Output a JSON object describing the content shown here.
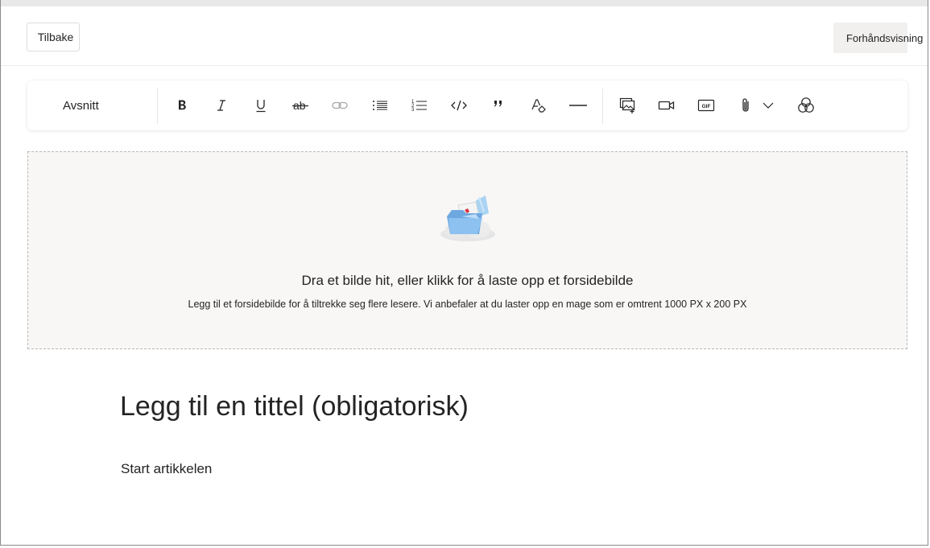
{
  "header": {
    "back_label": "Tilbake",
    "preview_label": "Forhåndsvisning"
  },
  "toolbar": {
    "paragraph_style": "Avsnitt",
    "buttons": [
      {
        "name": "bold",
        "icon": "bold-icon"
      },
      {
        "name": "italic",
        "icon": "italic-icon"
      },
      {
        "name": "underline",
        "icon": "underline-icon"
      },
      {
        "name": "strikethrough",
        "icon": "strikethrough-icon"
      },
      {
        "name": "link",
        "icon": "link-icon"
      },
      {
        "name": "bulleted-list",
        "icon": "bulleted-list-icon"
      },
      {
        "name": "numbered-list",
        "icon": "numbered-list-icon"
      },
      {
        "name": "code",
        "icon": "code-icon"
      },
      {
        "name": "quote",
        "icon": "quote-icon"
      },
      {
        "name": "clear-formatting",
        "icon": "clear-formatting-icon"
      },
      {
        "name": "horizontal-rule",
        "icon": "horizontal-rule-icon"
      },
      {
        "name": "insert-image",
        "icon": "image-icon"
      },
      {
        "name": "insert-video",
        "icon": "video-icon"
      },
      {
        "name": "insert-gif",
        "icon": "gif-icon",
        "text": "GIF"
      },
      {
        "name": "attach-file",
        "icon": "paperclip-icon"
      },
      {
        "name": "attach-dropdown",
        "icon": "chevron-down-icon"
      },
      {
        "name": "loop-component",
        "icon": "loop-icon"
      }
    ]
  },
  "cover_image": {
    "title": "Dra et bilde hit, eller klikk for å laste opp et forsidebilde",
    "subtitle": "Legg til et forsidebilde for å tiltrekke seg flere lesere. Vi anbefaler at du laster opp en mage som er omtrent 1000 PX x 200 PX",
    "illustration": "folder-upload-illustration"
  },
  "article": {
    "title_placeholder": "Legg til en tittel (obligatorisk)",
    "body_placeholder": "Start artikkelen"
  },
  "colors": {
    "icon": "#242424",
    "disabled_icon": "#a6a6a6",
    "dropzone_bg": "#f8f7f6",
    "preview_bg": "#f1f0ef"
  }
}
